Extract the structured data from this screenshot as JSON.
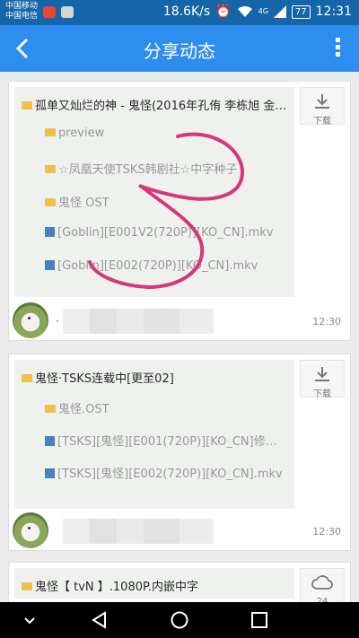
{
  "status_bar": {
    "carrier_1": "中国移动",
    "carrier_2": "中国电信",
    "speed": "18.6K/s",
    "network_label": "4G",
    "battery": "77",
    "time": "12:31"
  },
  "app_bar": {
    "title": "分享动态",
    "back_icon": "chevron-left-icon",
    "more_icon": "more-vertical-icon"
  },
  "cards": [
    {
      "title": "孤单又灿烂的神 - 鬼怪(2016年孔侑 李栋旭 金高…",
      "files": [
        {
          "type": "folder",
          "name": "preview"
        },
        {
          "type": "folder",
          "name": "☆凤凰天使TSKS韩剧社☆中字种子"
        },
        {
          "type": "folder",
          "name": "鬼怪 OST"
        },
        {
          "type": "video",
          "name": "[Goblin][E001V2(720P)][KO_CN].mkv"
        },
        {
          "type": "video",
          "name": "[Goblin][E002(720P)][KO_CN].mkv"
        }
      ],
      "action_label": "下载",
      "user": "·",
      "time": "12:30"
    },
    {
      "title": "鬼怪·TSKS连载中[更至02]",
      "files": [
        {
          "type": "folder",
          "name": "鬼怪.OST"
        },
        {
          "type": "video",
          "name": "[TSKS][鬼怪][E001(720P)][KO_CN]修正版…"
        },
        {
          "type": "video",
          "name": "[TSKS][鬼怪][E002(720P)][KO_CN].mkv"
        }
      ],
      "action_label": "下载",
      "user": "",
      "time": "12:30"
    },
    {
      "title": "鬼怪【 tvN 】.1080P.内嵌中字",
      "action_count": "24"
    }
  ],
  "colors": {
    "app_bar": "#2d8ef0",
    "status_bar": "#1565a8",
    "scribble": "#d6367a",
    "folder": "#f0bf4c",
    "video": "#4a7fc0"
  }
}
